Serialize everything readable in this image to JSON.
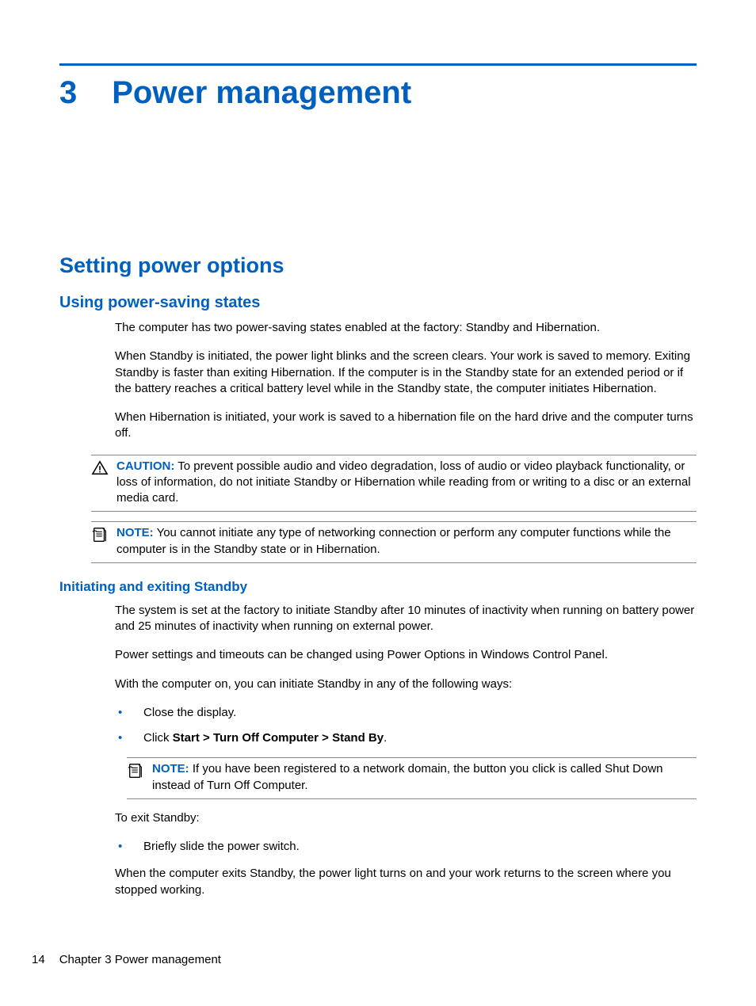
{
  "chapter": {
    "number": "3",
    "title": "Power management"
  },
  "section": {
    "title": "Setting power options"
  },
  "subsection1": {
    "title": "Using power-saving states",
    "para1": "The computer has two power-saving states enabled at the factory: Standby and Hibernation.",
    "para2": "When Standby is initiated, the power light blinks and the screen clears. Your work is saved to memory. Exiting Standby is faster than exiting Hibernation. If the computer is in the Standby state for an extended period or if the battery reaches a critical battery level while in the Standby state, the computer initiates Hibernation.",
    "para3": "When Hibernation is initiated, your work is saved to a hibernation file on the hard drive and the computer turns off.",
    "caution_label": "CAUTION:",
    "caution_text": " To prevent possible audio and video degradation, loss of audio or video playback functionality, or loss of information, do not initiate Standby or Hibernation while reading from or writing to a disc or an external media card.",
    "note_label": "NOTE:",
    "note_text": " You cannot initiate any type of networking connection or perform any computer functions while the computer is in the Standby state or in Hibernation."
  },
  "subsection2": {
    "title": "Initiating and exiting Standby",
    "para1": "The system is set at the factory to initiate Standby after 10 minutes of inactivity when running on battery power and 25 minutes of inactivity when running on external power.",
    "para2": "Power settings and timeouts can be changed using Power Options in Windows Control Panel.",
    "para3": "With the computer on, you can initiate Standby in any of the following ways:",
    "list1_item1": "Close the display.",
    "list1_item2_prefix": "Click ",
    "list1_item2_bold": "Start > Turn Off Computer > Stand By",
    "list1_item2_suffix": ".",
    "nested_note_label": "NOTE:",
    "nested_note_text": " If you have been registered to a network domain, the button you click is called Shut Down instead of Turn Off Computer.",
    "para4": "To exit Standby:",
    "list2_item1": "Briefly slide the power switch.",
    "para5": "When the computer exits Standby, the power light turns on and your work returns to the screen where you stopped working."
  },
  "footer": {
    "page_number": "14",
    "chapter_ref": "Chapter 3   Power management"
  }
}
